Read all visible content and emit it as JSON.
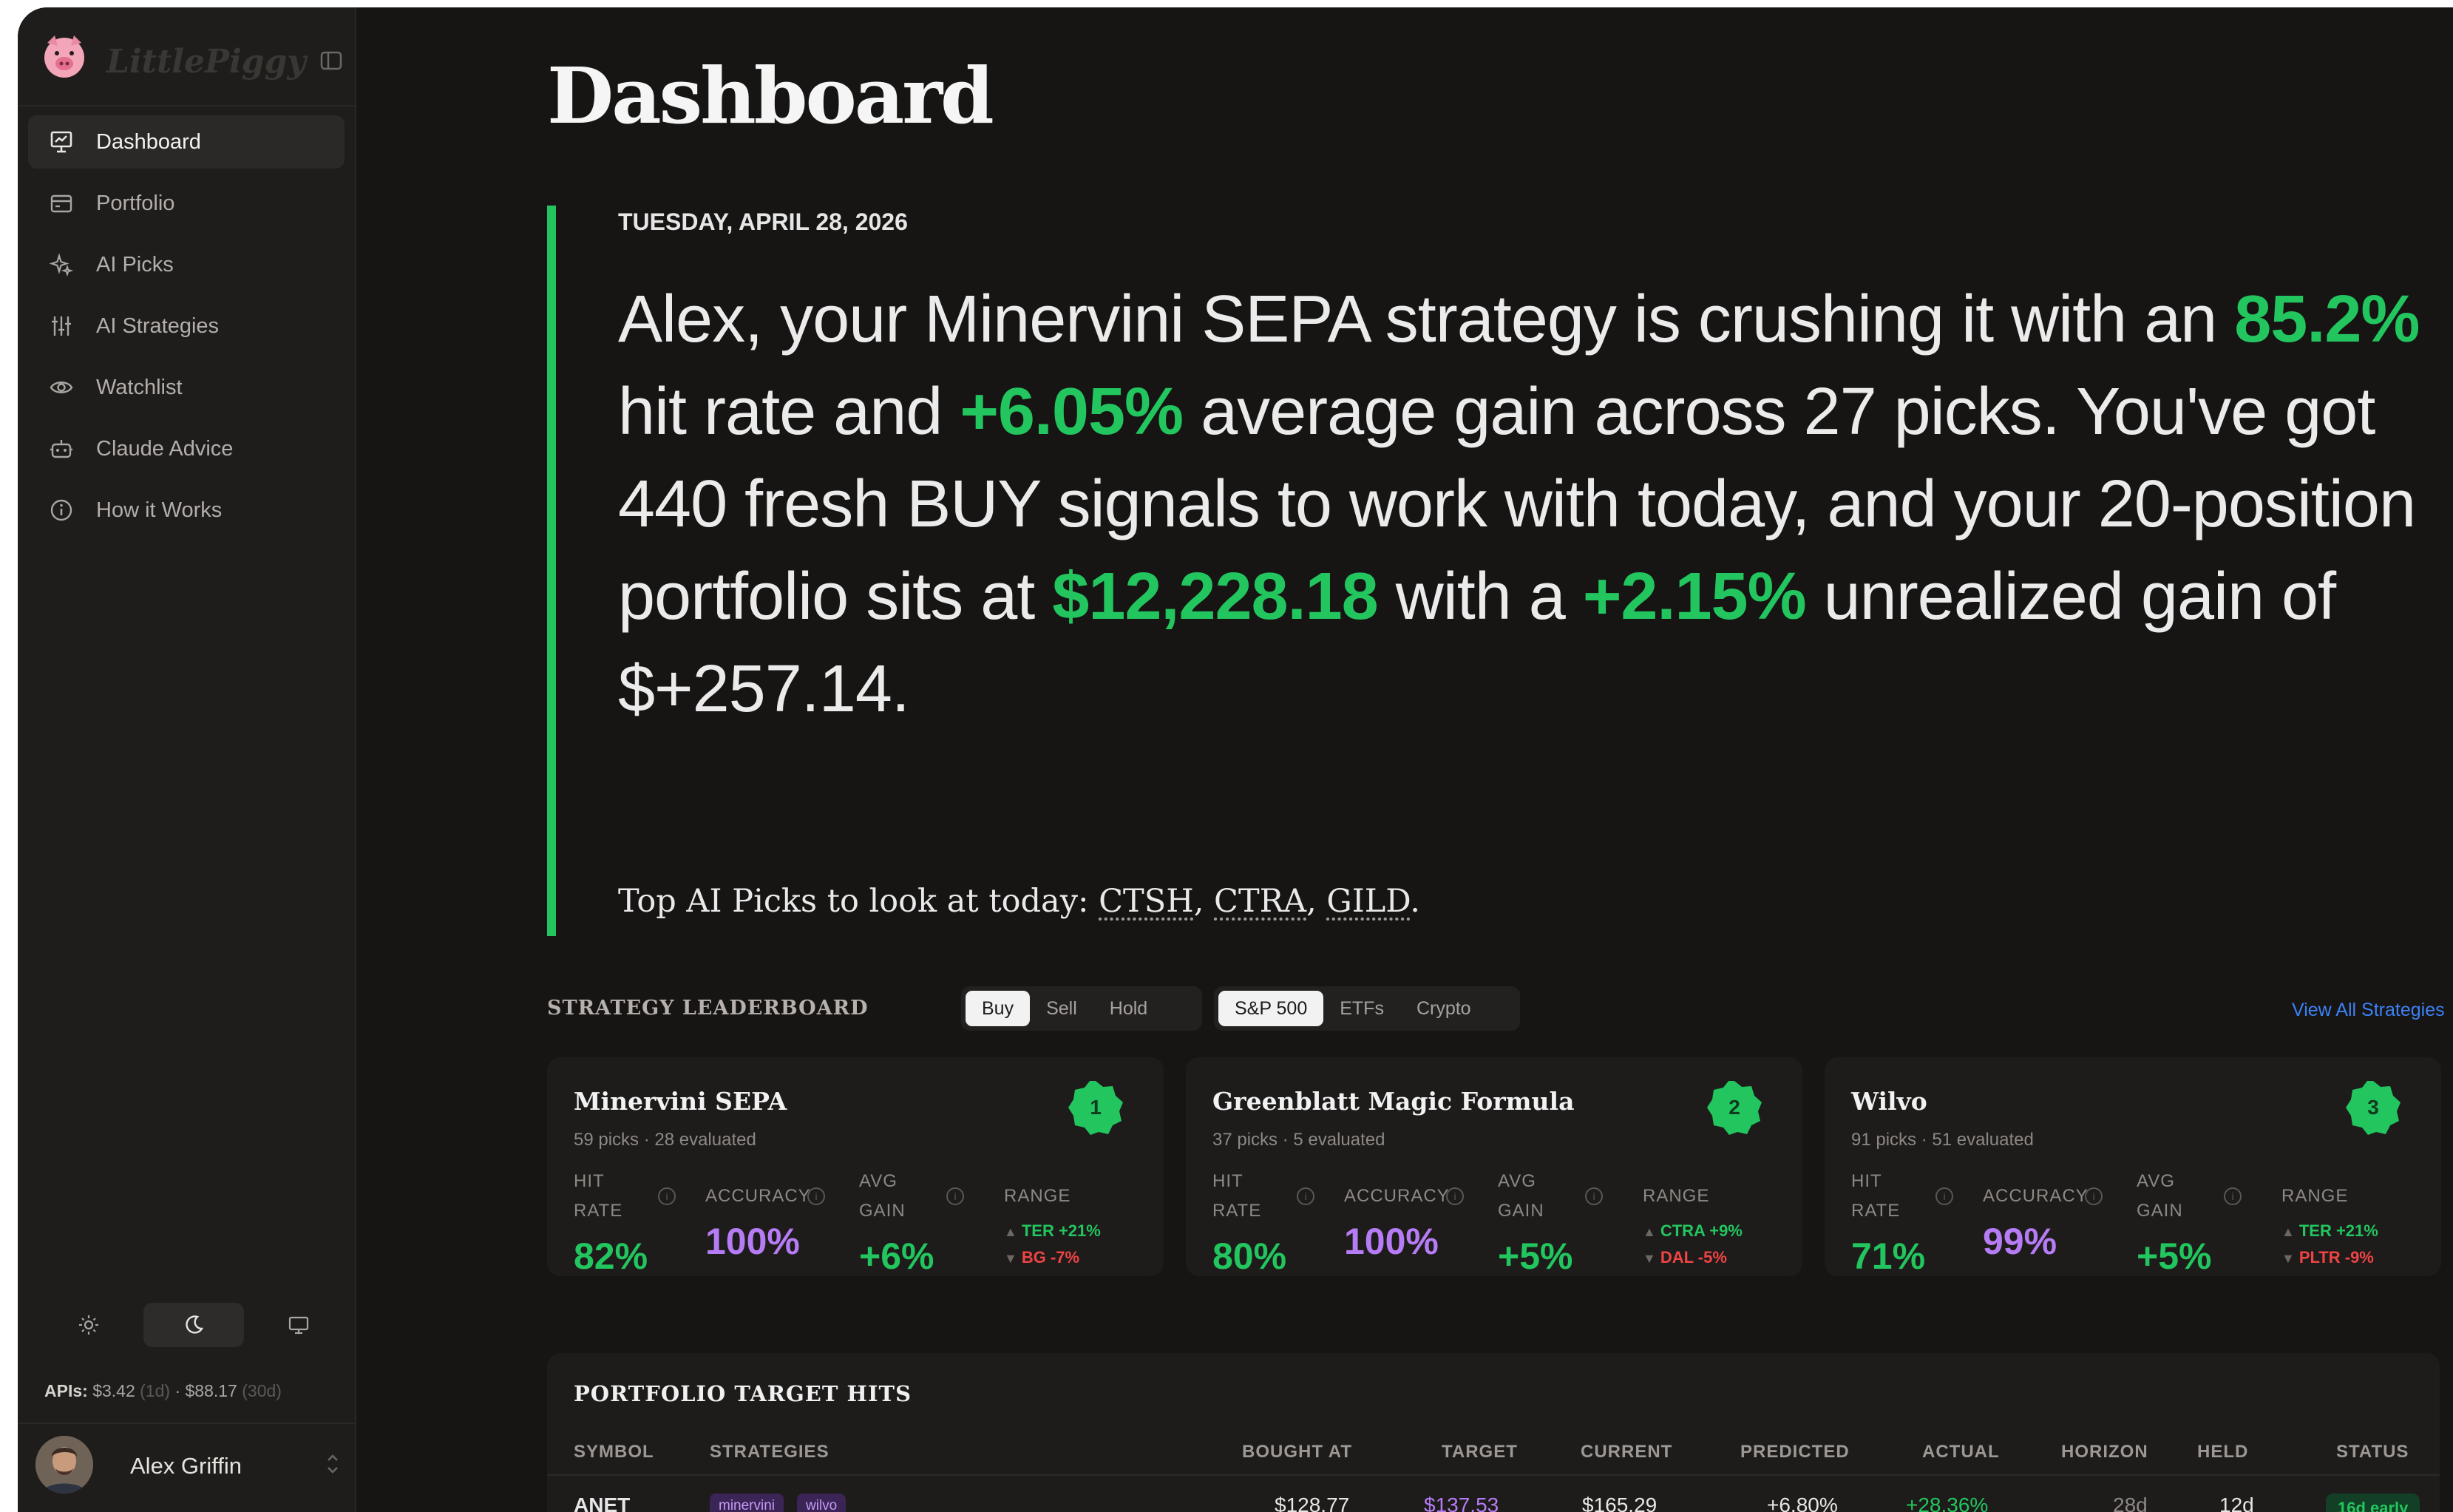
{
  "app": {
    "logo_text": "LittlePiggy"
  },
  "sidebar": {
    "items": [
      {
        "label": "Dashboard",
        "icon": "presentation-chart-icon",
        "active": true
      },
      {
        "label": "Portfolio",
        "icon": "wallet-icon",
        "active": false
      },
      {
        "label": "AI Picks",
        "icon": "sparkles-icon",
        "active": false
      },
      {
        "label": "AI Strategies",
        "icon": "sliders-icon",
        "active": false
      },
      {
        "label": "Watchlist",
        "icon": "eye-icon",
        "active": false
      },
      {
        "label": "Claude Advice",
        "icon": "bot-icon",
        "active": false
      },
      {
        "label": "How it Works",
        "icon": "info-icon",
        "active": false
      }
    ],
    "theme": {
      "options": [
        "light",
        "dark",
        "system"
      ],
      "selected": "dark"
    },
    "apis": {
      "label": "APIs:",
      "day": "$3.42",
      "day_unit": "(1d)",
      "sep": "·",
      "month": "$88.17",
      "month_unit": "(30d)"
    },
    "user": {
      "name": "Alex Griffin"
    }
  },
  "main": {
    "title": "Dashboard",
    "date": "TUESDAY, APRIL 28, 2026",
    "summary": {
      "p1": "Alex, your Minervini SEPA strategy is crushing it with an ",
      "hit_rate": "85.2%",
      "p2": " hit rate and ",
      "avg_gain": "+6.05%",
      "p3": " average gain across 27 picks. You've got 440 fresh BUY signals to work with today, and your 20-position portfolio sits at ",
      "value": "$12,228.18",
      "p4": " with a ",
      "unrealized_pct": "+2.15%",
      "p5": " unrealized gain of $+257.14."
    },
    "top_picks": {
      "prefix": "Top AI Picks to look at today: ",
      "tickers": [
        "CTSH",
        "CTRA",
        "GILD"
      ],
      "sep": ", ",
      "suffix": "."
    },
    "leaderboard": {
      "title": "STRATEGY LEADERBOARD",
      "signal_tabs": [
        "Buy",
        "Sell",
        "Hold"
      ],
      "signal_selected": "Buy",
      "universe_tabs": [
        "S&P 500",
        "ETFs",
        "Crypto"
      ],
      "universe_selected": "S&P 500",
      "view_all": "View All Strategies",
      "labels": {
        "hit": "HIT",
        "rate": "RATE",
        "accuracy": "ACCURACY",
        "avg": "AVG",
        "gain": "GAIN",
        "range": "RANGE"
      },
      "cards": [
        {
          "rank": "1",
          "name": "Minervini SEPA",
          "sub": "59 picks · 28 evaluated",
          "hit_rate": "82%",
          "accuracy": "100%",
          "avg_gain": "+6%",
          "best": "TER +21%",
          "worst": "BG -7%"
        },
        {
          "rank": "2",
          "name": "Greenblatt Magic Formula",
          "sub": "37 picks · 5 evaluated",
          "hit_rate": "80%",
          "accuracy": "100%",
          "avg_gain": "+5%",
          "best": "CTRA +9%",
          "worst": "DAL -5%"
        },
        {
          "rank": "3",
          "name": "Wilvo",
          "sub": "91 picks · 51 evaluated",
          "hit_rate": "71%",
          "accuracy": "99%",
          "avg_gain": "+5%",
          "best": "TER +21%",
          "worst": "PLTR -9%"
        }
      ]
    },
    "targets": {
      "title": "PORTFOLIO TARGET HITS",
      "columns": [
        "SYMBOL",
        "STRATEGIES",
        "BOUGHT AT",
        "TARGET",
        "CURRENT",
        "PREDICTED",
        "ACTUAL",
        "HORIZON",
        "HELD",
        "STATUS"
      ],
      "rows": [
        {
          "symbol": "ANET",
          "strategies": [
            "minervini",
            "wilvo"
          ],
          "bought_at": "$128.77",
          "target": "$137.53",
          "current": "$165.29",
          "predicted": "+6.80%",
          "actual": "+28.36%",
          "horizon": "28d",
          "held": "12d",
          "status": "16d early"
        }
      ]
    }
  },
  "colors": {
    "accent_green": "#22c55e",
    "accent_purple": "#b67cf5",
    "negative_red": "#ef4444",
    "link_blue": "#3b82f6"
  }
}
